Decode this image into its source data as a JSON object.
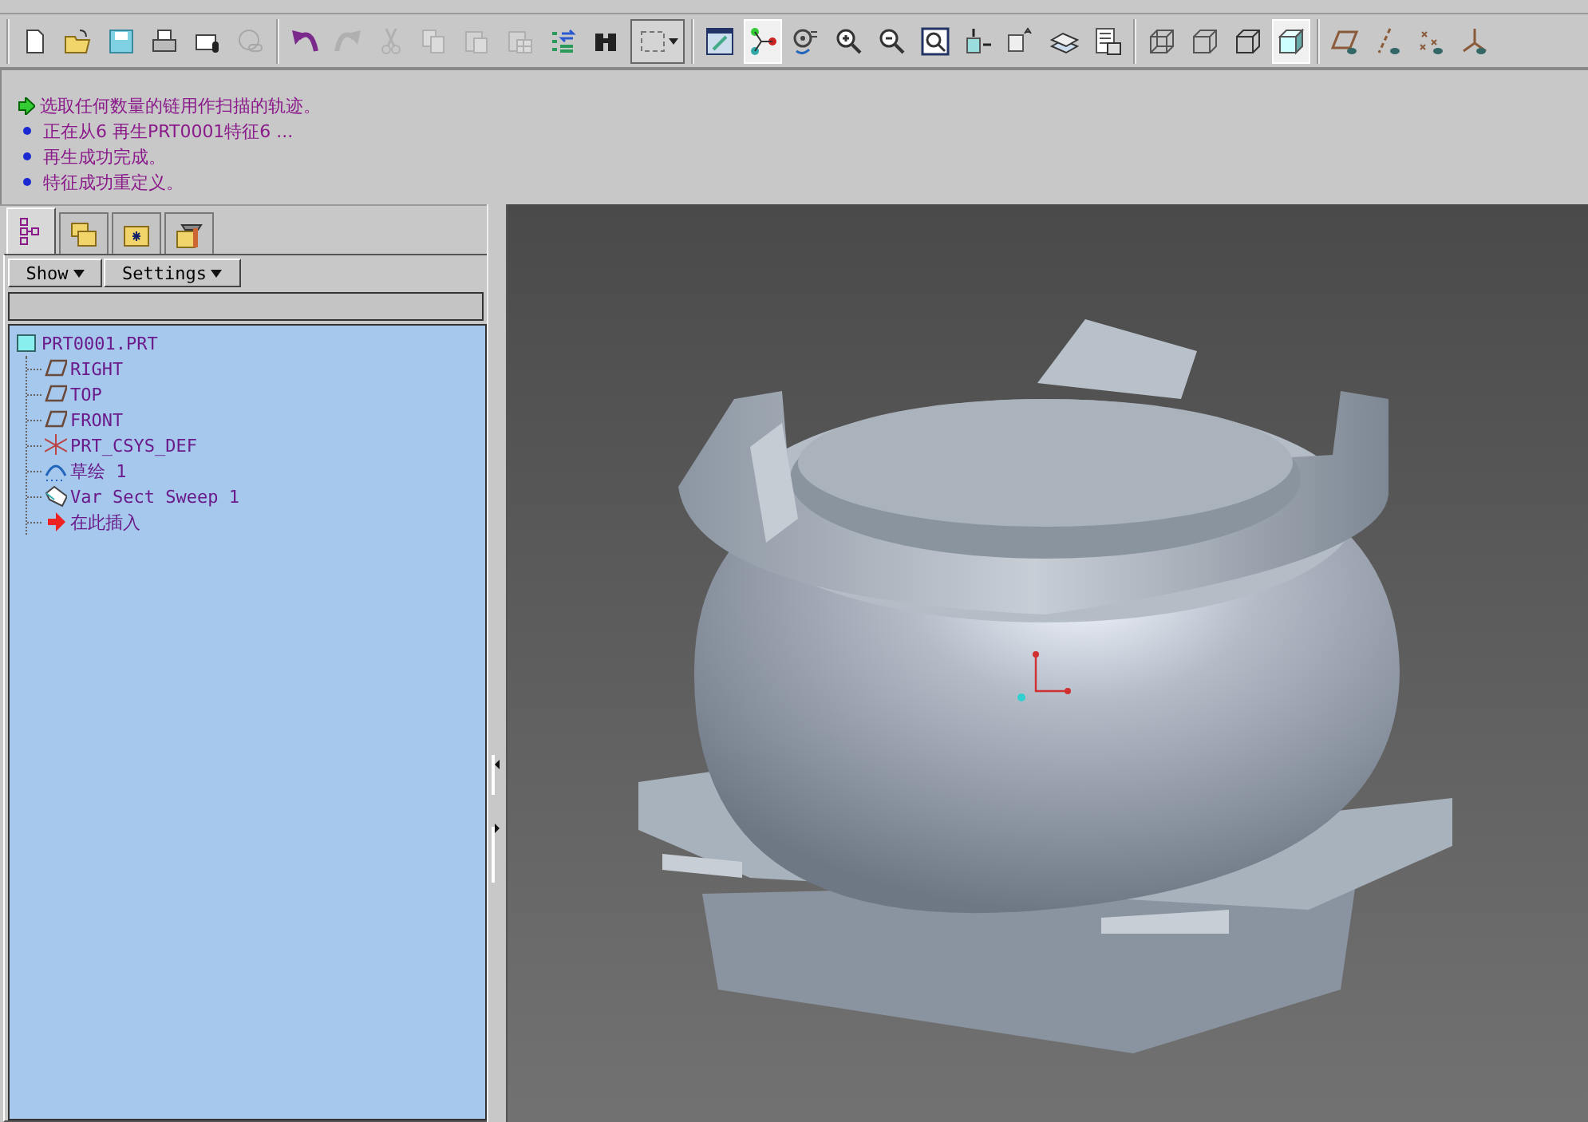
{
  "toolbar": {
    "groups": [
      {
        "buttons": [
          {
            "pressed": false,
            "disabled": false
          },
          {
            "pressed": false,
            "disabled": false
          },
          {
            "pressed": false,
            "disabled": false
          },
          {
            "pressed": false,
            "disabled": false
          },
          {
            "pressed": false,
            "disabled": false
          },
          {
            "pressed": false,
            "disabled": true
          }
        ]
      },
      {
        "buttons": [
          {
            "pressed": false,
            "disabled": false
          },
          {
            "pressed": false,
            "disabled": true
          },
          {
            "pressed": false,
            "disabled": true
          },
          {
            "pressed": false,
            "disabled": true
          },
          {
            "pressed": false,
            "disabled": true
          },
          {
            "pressed": false,
            "disabled": true
          },
          {
            "pressed": false,
            "disabled": false
          },
          {
            "pressed": false,
            "disabled": false
          },
          {
            "pressed": false,
            "disabled": false
          }
        ]
      },
      {
        "buttons": [
          {
            "pressed": false,
            "disabled": false
          },
          {
            "pressed": true,
            "disabled": false
          },
          {
            "pressed": false,
            "disabled": false
          },
          {
            "pressed": false,
            "disabled": false
          },
          {
            "pressed": false,
            "disabled": false
          },
          {
            "pressed": false,
            "disabled": false
          },
          {
            "pressed": false,
            "disabled": false
          },
          {
            "pressed": false,
            "disabled": false
          },
          {
            "pressed": false,
            "disabled": false
          },
          {
            "pressed": false,
            "disabled": false
          }
        ]
      },
      {
        "buttons": [
          {
            "pressed": false,
            "disabled": false
          },
          {
            "pressed": false,
            "disabled": false
          },
          {
            "pressed": false,
            "disabled": false
          },
          {
            "pressed": true,
            "disabled": false
          }
        ]
      },
      {
        "buttons": [
          {
            "pressed": false,
            "disabled": false
          },
          {
            "pressed": false,
            "disabled": false
          },
          {
            "pressed": false,
            "disabled": false
          },
          {
            "pressed": false,
            "disabled": false
          }
        ]
      }
    ]
  },
  "messages": [
    {
      "kind": "prompt",
      "text": "选取任何数量的链用作扫描的轨迹。"
    },
    {
      "kind": "info",
      "text": "正在从6 再生PRT0001特征6 ..."
    },
    {
      "kind": "info",
      "text": "再生成功完成。"
    },
    {
      "kind": "info",
      "text": "特征成功重定义。"
    }
  ],
  "navigator": {
    "tabs": [
      {
        "selected": true
      },
      {
        "selected": false
      },
      {
        "selected": false
      },
      {
        "selected": false
      }
    ],
    "buttons": [
      "Show",
      "Settings"
    ],
    "tree": {
      "kind": "part",
      "label": "PRT0001.PRT",
      "children": [
        {
          "kind": "plane",
          "label": "RIGHT"
        },
        {
          "kind": "plane",
          "label": "TOP"
        },
        {
          "kind": "plane",
          "label": "FRONT"
        },
        {
          "kind": "csys",
          "label": "PRT_CSYS_DEF"
        },
        {
          "kind": "sketch",
          "label": "草绘 1"
        },
        {
          "kind": "sweep",
          "label": "Var Sect Sweep 1"
        },
        {
          "kind": "insert",
          "label": "在此插入"
        }
      ]
    }
  }
}
